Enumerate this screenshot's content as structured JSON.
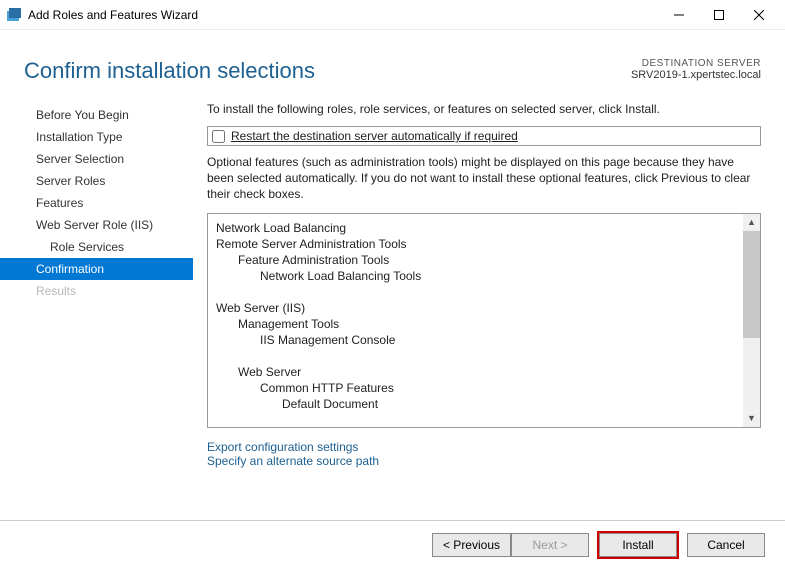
{
  "window": {
    "title": "Add Roles and Features Wizard"
  },
  "header": {
    "title": "Confirm installation selections",
    "destination_label": "DESTINATION SERVER",
    "destination_value": "SRV2019-1.xpertstec.local"
  },
  "sidebar": {
    "items": [
      {
        "label": "Before You Begin",
        "selected": false,
        "disabled": false,
        "sub": false
      },
      {
        "label": "Installation Type",
        "selected": false,
        "disabled": false,
        "sub": false
      },
      {
        "label": "Server Selection",
        "selected": false,
        "disabled": false,
        "sub": false
      },
      {
        "label": "Server Roles",
        "selected": false,
        "disabled": false,
        "sub": false
      },
      {
        "label": "Features",
        "selected": false,
        "disabled": false,
        "sub": false
      },
      {
        "label": "Web Server Role (IIS)",
        "selected": false,
        "disabled": false,
        "sub": false
      },
      {
        "label": "Role Services",
        "selected": false,
        "disabled": false,
        "sub": true
      },
      {
        "label": "Confirmation",
        "selected": true,
        "disabled": false,
        "sub": false
      },
      {
        "label": "Results",
        "selected": false,
        "disabled": true,
        "sub": false
      }
    ]
  },
  "main": {
    "intro": "To install the following roles, role services, or features on selected server, click Install.",
    "restart_label": "Restart the destination server automatically if required",
    "restart_checked": false,
    "optional_note": "Optional features (such as administration tools) might be displayed on this page because they have been selected automatically. If you do not want to install these optional features, click Previous to clear their check boxes.",
    "features_list": [
      {
        "text": "Network Load Balancing",
        "indent": 0
      },
      {
        "text": "Remote Server Administration Tools",
        "indent": 0
      },
      {
        "text": "Feature Administration Tools",
        "indent": 1
      },
      {
        "text": "Network Load Balancing Tools",
        "indent": 2
      },
      {
        "text": "",
        "indent": 0
      },
      {
        "text": "Web Server (IIS)",
        "indent": 0
      },
      {
        "text": "Management Tools",
        "indent": 1
      },
      {
        "text": "IIS Management Console",
        "indent": 2
      },
      {
        "text": "",
        "indent": 0
      },
      {
        "text": "Web Server",
        "indent": 1
      },
      {
        "text": "Common HTTP Features",
        "indent": 2
      },
      {
        "text": "Default Document",
        "indent": 3
      }
    ],
    "links": {
      "export": "Export configuration settings",
      "alt_path": "Specify an alternate source path"
    }
  },
  "footer": {
    "previous": "< Previous",
    "next": "Next >",
    "install": "Install",
    "cancel": "Cancel"
  }
}
